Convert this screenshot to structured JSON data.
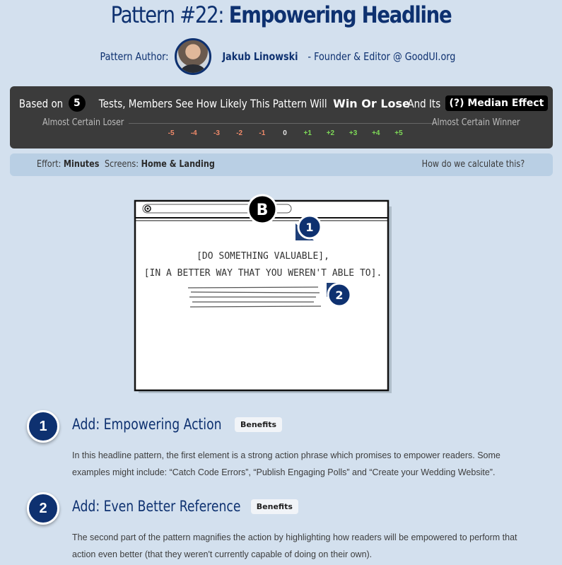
{
  "header": {
    "title_prefix": "Pattern #22:",
    "title_main": "Empowering Headline"
  },
  "author": {
    "label": "Pattern Author:",
    "name": "Jakub Linowski",
    "role": "- Founder & Editor @ GoodUI.org"
  },
  "results": {
    "based_on": "Based on",
    "test_count": "5",
    "sentence": "Tests, Members See How Likely This Pattern Will",
    "win_or_lose": "Win Or Lose",
    "and_its": "And Its",
    "median_effect": "(?) Median Effect",
    "left_label": "Almost Certain Loser",
    "right_label": "Almost Certain Winner",
    "scale": [
      "-5",
      "-4",
      "-3",
      "-2",
      "-1",
      "0",
      "+1",
      "+2",
      "+3",
      "+4",
      "+5"
    ],
    "scale_colors": {
      "negative": "#f08a6a",
      "zero": "#e6e6e6",
      "positive": "#7ed957"
    }
  },
  "effort": {
    "effort_label": "Effort:",
    "effort_value": "Minutes",
    "screens_label": "Screens:",
    "screens_value": "Home & Landing",
    "calc_link": "How do we calculate this?"
  },
  "sketch": {
    "variant": "B",
    "line1": "[DO SOMETHING VALUABLE],",
    "line2": "[IN A BETTER WAY THAT YOU WEREN'T ABLE TO].",
    "marker1": "1",
    "marker2": "2"
  },
  "steps": [
    {
      "number": "1",
      "title": "Add: Empowering Action",
      "badge": "Benefits",
      "description": "In this headline pattern, the first element is a strong action phrase which promises to empower readers. Some examples might include: “Catch Code Errors”, “Publish Engaging Polls” and “Create your Wedding Website”."
    },
    {
      "number": "2",
      "title": "Add: Even Better Reference",
      "badge": "Benefits",
      "description": "The second part of the pattern magnifies the action by highlighting how readers will be empowered to perform that action even better (that they weren't currently capable of doing on their own)."
    }
  ]
}
